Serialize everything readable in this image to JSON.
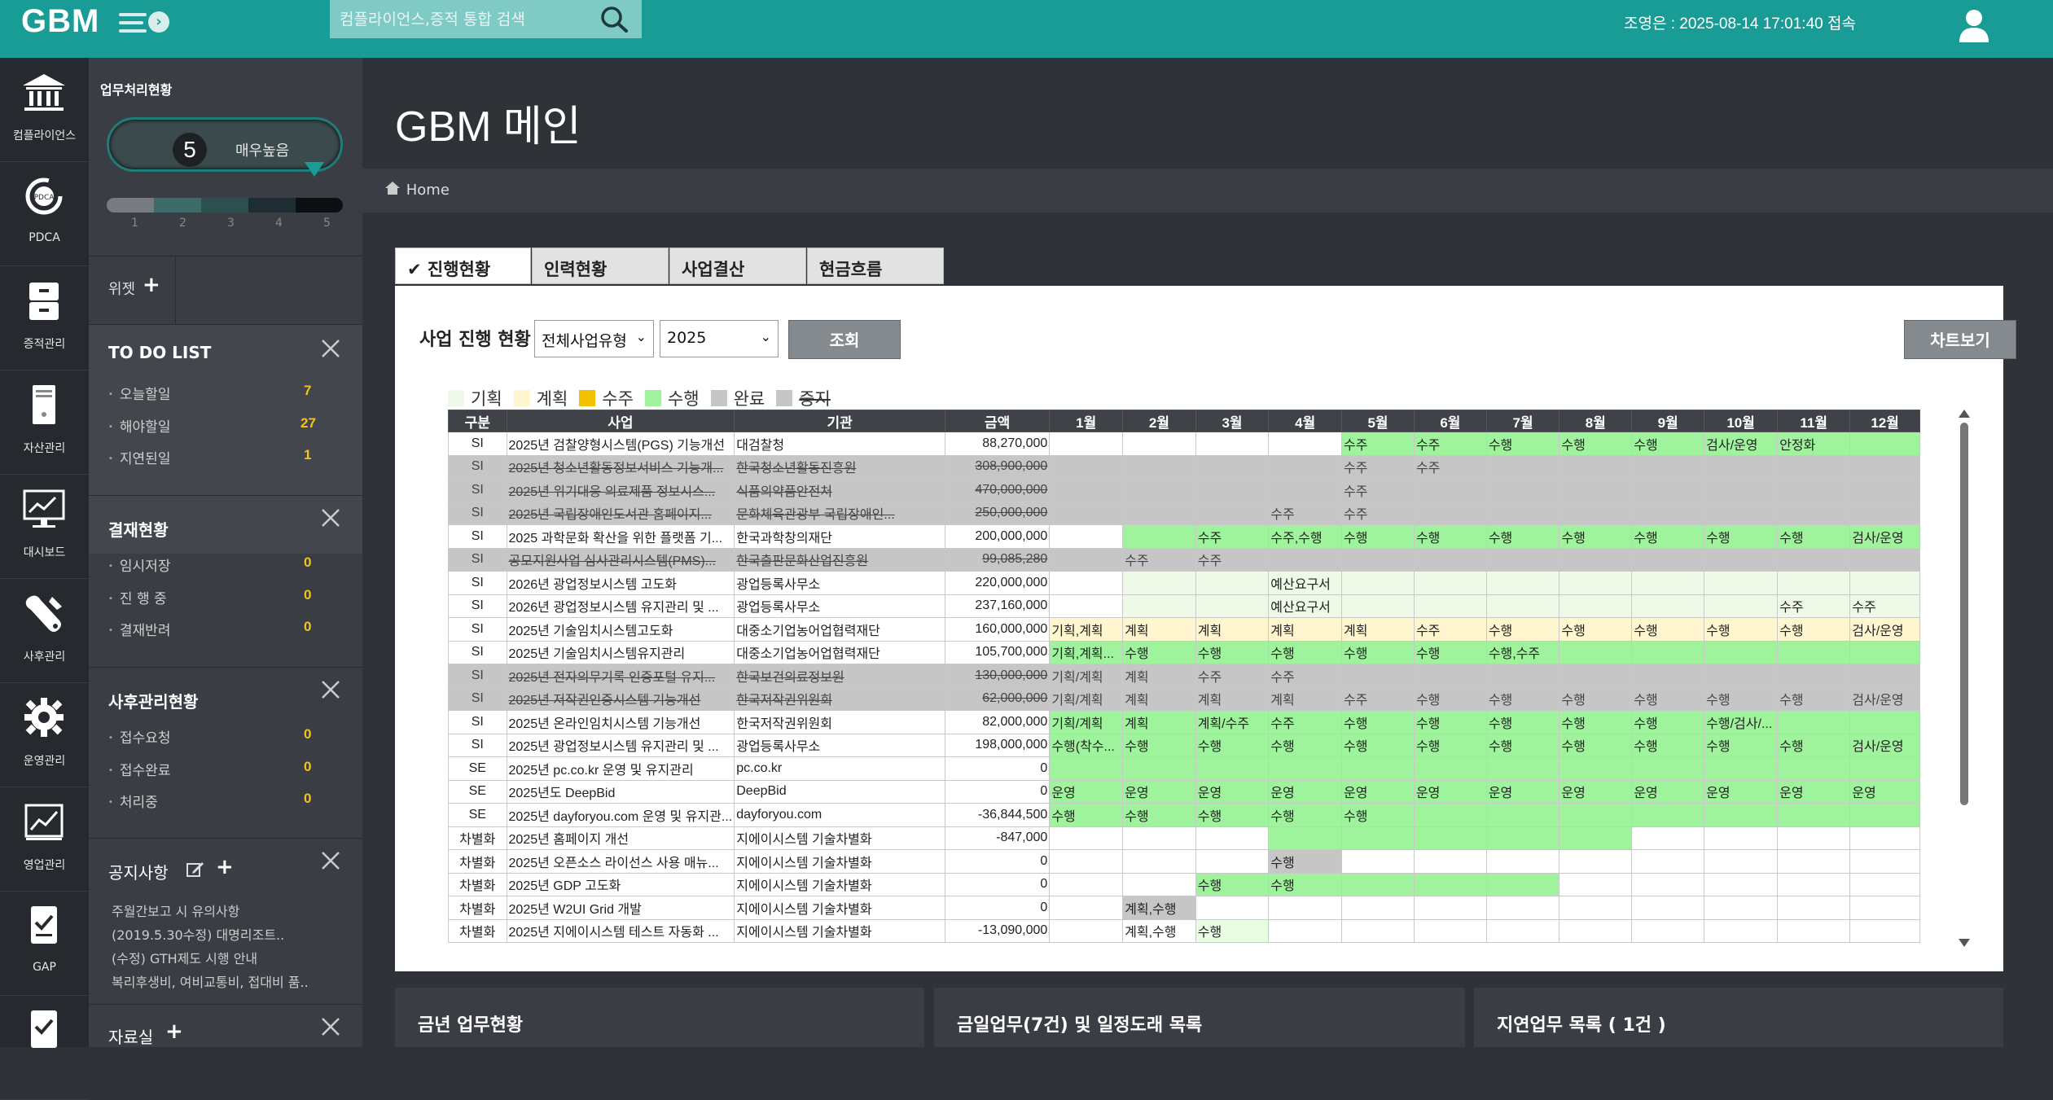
{
  "app": {
    "logo": "GBM",
    "search_placeholder": "컴플라이언스,증적 통합 검색",
    "session": "조영은 : 2025-08-14 17:01:40 접속"
  },
  "nav": [
    {
      "label": "컴플라이언스",
      "icon": "bank-icon"
    },
    {
      "label": "PDCA",
      "icon": "pdca-cycle-icon"
    },
    {
      "label": "증적관리",
      "icon": "file-drawer-icon"
    },
    {
      "label": "자산관리",
      "icon": "server-icon"
    },
    {
      "label": "대시보드",
      "icon": "monitor-chart-icon"
    },
    {
      "label": "사후관리",
      "icon": "wrench-icon"
    },
    {
      "label": "운영관리",
      "icon": "gear-icon"
    },
    {
      "label": "영업관리",
      "icon": "trend-chart-icon"
    },
    {
      "label": "GAP",
      "icon": "checklist-icon"
    },
    {
      "label": "",
      "icon": "checklist-icon"
    }
  ],
  "panel": {
    "status_title": "업무처리현황",
    "gauge_value": "5",
    "gauge_label": "매우높음",
    "scale": [
      "1",
      "2",
      "3",
      "4",
      "5"
    ],
    "widget_label": "위젯",
    "todo": {
      "title": "TO DO LIST",
      "items": [
        {
          "label": "오늘할일",
          "count": "7"
        },
        {
          "label": "해야할일",
          "count": "27"
        },
        {
          "label": "지연된일",
          "count": "1"
        }
      ]
    },
    "approval": {
      "title": "결재현황",
      "items": [
        {
          "label": "임시저장",
          "count": "0"
        },
        {
          "label": "진 행 중",
          "count": "0"
        },
        {
          "label": "결재반려",
          "count": "0"
        }
      ]
    },
    "aftercare": {
      "title": "사후관리현황",
      "items": [
        {
          "label": "접수요청",
          "count": "0"
        },
        {
          "label": "접수완료",
          "count": "0"
        },
        {
          "label": "처리중",
          "count": "0"
        }
      ]
    },
    "notice": {
      "title": "공지사항",
      "items": [
        "주월간보고 시 유의사항",
        "(2019.5.30수정) 대명리조트..",
        "(수정) GTH제도 시행 안내",
        "복리후생비, 여비교통비, 접대비 품.."
      ]
    },
    "library": {
      "title": "자료실"
    }
  },
  "main": {
    "page_title": "GBM 메인",
    "breadcrumb": "Home",
    "tabs": [
      "진행현황",
      "인력현황",
      "사업결산",
      "현금흐름"
    ],
    "section_title": "사업 진행 현황",
    "type_select": "전체사업유형",
    "year_select": "2025",
    "query_button": "조회",
    "chart_button": "차트보기",
    "legend": [
      {
        "label": "기획",
        "color": "#eef9e8"
      },
      {
        "label": "계획",
        "color": "#fff6cf"
      },
      {
        "label": "수주",
        "color": "#f2c200"
      },
      {
        "label": "수행",
        "color": "#9ff39c"
      },
      {
        "label": "완료",
        "color": "#c6c6c6"
      },
      {
        "label": "중지",
        "color": "#c6c6c6"
      }
    ],
    "columns": [
      "구분",
      "사업",
      "기관",
      "금액",
      "1월",
      "2월",
      "3월",
      "4월",
      "5월",
      "6월",
      "7월",
      "8월",
      "9월",
      "10월",
      "11월",
      "12월"
    ],
    "bottom_cards": [
      "금년 업무현황",
      "금일업무(7건) 및 일정도래 목록",
      "지연업무 목록 ( 1건 )"
    ]
  },
  "table_rows": [
    {
      "kind": "SI",
      "name": "2025년 검찰양형시스템(PGS) 기능개선",
      "org": "대검찰청",
      "amt": "88,270,000",
      "dead": false,
      "m": [
        "",
        "",
        "",
        "",
        "수주",
        "수주",
        "수행",
        "수행",
        "수행",
        "검사/운영",
        "안정화",
        ""
      ],
      "bg": [
        "",
        "",
        "",
        "",
        "g",
        "g",
        "g",
        "g",
        "g",
        "g",
        "g",
        "g"
      ]
    },
    {
      "kind": "SI",
      "name": "2025년 청소년활동정보서비스 기능개...",
      "org": "한국청소년활동진흥원",
      "amt": "308,900,000",
      "dead": true,
      "m": [
        "",
        "",
        "",
        "",
        "수주",
        "수주",
        "",
        "",
        "",
        "",
        "",
        ""
      ],
      "bg": [
        "",
        "",
        "",
        "",
        "",
        "",
        "",
        "",
        "",
        "",
        "",
        ""
      ]
    },
    {
      "kind": "SI",
      "name": "2025년 위기대응 의료제품 정보시스...",
      "org": "식품의약품안전처",
      "amt": "470,000,000",
      "dead": true,
      "m": [
        "",
        "",
        "",
        "",
        "수주",
        "",
        "",
        "",
        "",
        "",
        "",
        ""
      ],
      "bg": [
        "",
        "",
        "",
        "",
        "",
        "",
        "",
        "",
        "",
        "",
        "",
        ""
      ]
    },
    {
      "kind": "SI",
      "name": "2025년 국립장애인도서관 홈페이지...",
      "org": "문화체육관광부 국립장애인...",
      "amt": "250,000,000",
      "dead": true,
      "m": [
        "",
        "",
        "",
        "수주",
        "수주",
        "",
        "",
        "",
        "",
        "",
        "",
        ""
      ],
      "bg": [
        "",
        "",
        "",
        "",
        "",
        "",
        "",
        "",
        "",
        "",
        "",
        ""
      ]
    },
    {
      "kind": "SI",
      "name": "2025 과학문화 확산을 위한 플랫폼 기...",
      "org": "한국과학창의재단",
      "amt": "200,000,000",
      "dead": false,
      "m": [
        "",
        "",
        "수주",
        "수주,수행",
        "수행",
        "수행",
        "수행",
        "수행",
        "수행",
        "수행",
        "수행",
        "검사/운영"
      ],
      "bg": [
        "",
        "g",
        "g",
        "g",
        "g",
        "g",
        "g",
        "g",
        "g",
        "g",
        "g",
        "g"
      ]
    },
    {
      "kind": "SI",
      "name": "공모지원사업 심사관리시스템(PMS)...",
      "org": "한국출판문화산업진흥원",
      "amt": "99,085,280",
      "dead": true,
      "m": [
        "",
        "수주",
        "수주",
        "",
        "",
        "",
        "",
        "",
        "",
        "",
        "",
        ""
      ],
      "bg": [
        "",
        "",
        "",
        "",
        "",
        "",
        "",
        "",
        "",
        "",
        "",
        ""
      ]
    },
    {
      "kind": "SI",
      "name": "2026년 광업정보시스템 고도화",
      "org": "광업등록사무소",
      "amt": "220,000,000",
      "dead": false,
      "m": [
        "",
        "",
        "",
        "예산요구서",
        "",
        "",
        "",
        "",
        "",
        "",
        "",
        ""
      ],
      "bg": [
        "",
        "p",
        "p",
        "p",
        "p",
        "p",
        "p",
        "p",
        "p",
        "p",
        "p",
        "p"
      ]
    },
    {
      "kind": "SI",
      "name": "2026년 광업정보시스템 유지관리 및 ...",
      "org": "광업등록사무소",
      "amt": "237,160,000",
      "dead": false,
      "m": [
        "",
        "",
        "",
        "예산요구서",
        "",
        "",
        "",
        "",
        "",
        "",
        "수주",
        "수주"
      ],
      "bg": [
        "",
        "p",
        "p",
        "p",
        "p",
        "p",
        "p",
        "p",
        "p",
        "p",
        "p",
        "p"
      ]
    },
    {
      "kind": "SI",
      "name": "2025년 기술임치시스템고도화",
      "org": "대중소기업농어업협력재단",
      "amt": "160,000,000",
      "dead": false,
      "m": [
        "기획,계획",
        "계획",
        "계획",
        "계획",
        "계획",
        "수주",
        "수행",
        "수행",
        "수행",
        "수행",
        "수행",
        "검사/운영"
      ],
      "bg": [
        "y",
        "y",
        "y",
        "y",
        "y",
        "y",
        "y",
        "y",
        "y",
        "y",
        "y",
        "y"
      ]
    },
    {
      "kind": "SI",
      "name": "2025년 기술임치시스템유지관리",
      "org": "대중소기업농어업협력재단",
      "amt": "105,700,000",
      "dead": false,
      "m": [
        "기획,계획...",
        "수행",
        "수행",
        "수행",
        "수행",
        "수행",
        "수행,수주",
        "",
        "",
        "",
        "",
        ""
      ],
      "bg": [
        "g",
        "g",
        "g",
        "g",
        "g",
        "g",
        "g",
        "g",
        "g",
        "g",
        "g",
        "g"
      ]
    },
    {
      "kind": "SI",
      "name": "2025년 전자의무기록 인증포털 유지...",
      "org": "한국보건의료정보원",
      "amt": "130,000,000",
      "dead": true,
      "m": [
        "기획/계획",
        "계획",
        "수주",
        "수주",
        "",
        "",
        "",
        "",
        "",
        "",
        "",
        ""
      ],
      "bg": [
        "",
        "",
        "",
        "",
        "",
        "",
        "",
        "",
        "",
        "",
        "",
        ""
      ]
    },
    {
      "kind": "SI",
      "name": "2025년 저작권인증시스템 기능개선",
      "org": "한국저작권위원회",
      "amt": "62,000,000",
      "dead": true,
      "m": [
        "기획/계획",
        "계획",
        "계획",
        "계획",
        "수주",
        "수행",
        "수행",
        "수행",
        "수행",
        "수행",
        "수행",
        "검사/운영"
      ],
      "bg": [
        "",
        "",
        "",
        "",
        "",
        "",
        "",
        "",
        "",
        "",
        "",
        ""
      ]
    },
    {
      "kind": "SI",
      "name": "2025년 온라인임치시스템 기능개선",
      "org": "한국저작권위원회",
      "amt": "82,000,000",
      "dead": false,
      "m": [
        "기획/계획",
        "계획",
        "계획/수주",
        "수주",
        "수행",
        "수행",
        "수행",
        "수행",
        "수행",
        "수행/검사/...",
        "",
        ""
      ],
      "bg": [
        "g",
        "g",
        "g",
        "g",
        "g",
        "g",
        "g",
        "g",
        "g",
        "g",
        "g",
        "g"
      ]
    },
    {
      "kind": "SI",
      "name": "2025년 광업정보시스템 유지관리 및 ...",
      "org": "광업등록사무소",
      "amt": "198,000,000",
      "dead": false,
      "m": [
        "수행(착수...",
        "수행",
        "수행",
        "수행",
        "수행",
        "수행",
        "수행",
        "수행",
        "수행",
        "수행",
        "수행",
        "검사/운영"
      ],
      "bg": [
        "g",
        "g",
        "g",
        "g",
        "g",
        "g",
        "g",
        "g",
        "g",
        "g",
        "g",
        "g"
      ]
    },
    {
      "kind": "SE",
      "name": "2025년 pc.co.kr 운영 및 유지관리",
      "org": "pc.co.kr",
      "amt": "0",
      "dead": false,
      "m": [
        "",
        "",
        "",
        "",
        "",
        "",
        "",
        "",
        "",
        "",
        "",
        ""
      ],
      "bg": [
        "g",
        "g",
        "g",
        "g",
        "g",
        "g",
        "g",
        "g",
        "g",
        "g",
        "g",
        "g"
      ]
    },
    {
      "kind": "SE",
      "name": "2025년도 DeepBid",
      "org": "DeepBid",
      "amt": "0",
      "dead": false,
      "m": [
        "운영",
        "운영",
        "운영",
        "운영",
        "운영",
        "운영",
        "운영",
        "운영",
        "운영",
        "운영",
        "운영",
        "운영"
      ],
      "bg": [
        "g",
        "g",
        "g",
        "g",
        "g",
        "g",
        "g",
        "g",
        "g",
        "g",
        "g",
        "g"
      ]
    },
    {
      "kind": "SE",
      "name": "2025년 dayforyou.com 운영 및 유지관...",
      "org": "dayforyou.com",
      "amt": "-36,844,500",
      "dead": false,
      "m": [
        "수행",
        "수행",
        "수행",
        "수행",
        "수행",
        "",
        "",
        "",
        "",
        "",
        "",
        ""
      ],
      "bg": [
        "g",
        "g",
        "g",
        "g",
        "g",
        "g",
        "g",
        "g",
        "g",
        "g",
        "g",
        "g"
      ]
    },
    {
      "kind": "차별화",
      "name": "2025년 홈페이지 개선",
      "org": "지에이시스템 기술차별화",
      "amt": "-847,000",
      "dead": false,
      "m": [
        "",
        "",
        "",
        "",
        "",
        "",
        "",
        "",
        "",
        "",
        "",
        ""
      ],
      "bg": [
        "",
        "",
        "",
        "g",
        "g",
        "g",
        "g",
        "g",
        "",
        "",
        "",
        ""
      ]
    },
    {
      "kind": "차별화",
      "name": "2025년 오픈소스 라이선스 사용 매뉴...",
      "org": "지에이시스템 기술차별화",
      "amt": "0",
      "dead": false,
      "m": [
        "",
        "",
        "",
        "수행",
        "",
        "",
        "",
        "",
        "",
        "",
        "",
        ""
      ],
      "bg": [
        "",
        "",
        "",
        "s",
        "",
        "",
        "",
        "",
        "",
        "",
        "",
        ""
      ]
    },
    {
      "kind": "차별화",
      "name": "2025년 GDP 고도화",
      "org": "지에이시스템 기술차별화",
      "amt": "0",
      "dead": false,
      "m": [
        "",
        "",
        "수행",
        "수행",
        "",
        "",
        "",
        "",
        "",
        "",
        "",
        ""
      ],
      "bg": [
        "",
        "",
        "g",
        "g",
        "g",
        "g",
        "g",
        "",
        "",
        "",
        "",
        ""
      ]
    },
    {
      "kind": "차별화",
      "name": "2025년 W2UI Grid 개발",
      "org": "지에이시스템 기술차별화",
      "amt": "0",
      "dead": false,
      "m": [
        "",
        "계획,수행",
        "",
        "",
        "",
        "",
        "",
        "",
        "",
        "",
        "",
        ""
      ],
      "bg": [
        "",
        "s",
        "",
        "",
        "",
        "",
        "",
        "",
        "",
        "",
        "",
        ""
      ]
    },
    {
      "kind": "차별화",
      "name": "2025년 지에이시스템 테스트 자동화 ...",
      "org": "지에이시스템 기술차별화",
      "amt": "-13,090,000",
      "dead": false,
      "m": [
        "",
        "계획,수행",
        "수행",
        "",
        "",
        "",
        "",
        "",
        "",
        "",
        "",
        ""
      ],
      "bg": [
        "",
        "",
        "l",
        "",
        "",
        "",
        "",
        "",
        "",
        "",
        "",
        ""
      ]
    }
  ]
}
